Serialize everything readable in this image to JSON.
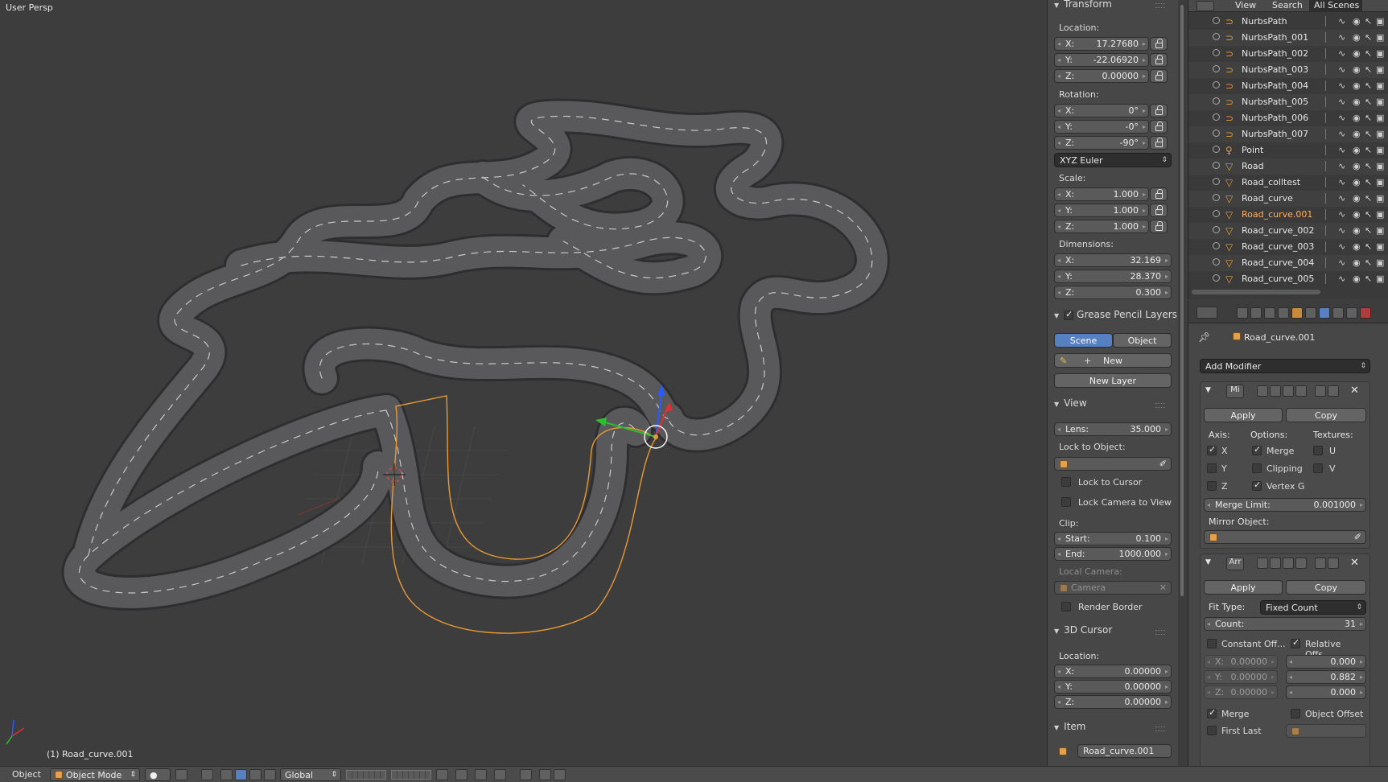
{
  "viewport": {
    "view_name": "User Persp",
    "object_info": "(1) Road_curve.001"
  },
  "npanel": {
    "transform": {
      "title": "Transform",
      "location_label": "Location:",
      "location": [
        {
          "k": "X:",
          "v": "17.27680"
        },
        {
          "k": "Y:",
          "v": "-22.06920"
        },
        {
          "k": "Z:",
          "v": "0.00000"
        }
      ],
      "rotation_label": "Rotation:",
      "rotation": [
        {
          "k": "X:",
          "v": "0°"
        },
        {
          "k": "Y:",
          "v": "-0°"
        },
        {
          "k": "Z:",
          "v": "-90°"
        }
      ],
      "rotation_mode": "XYZ Euler",
      "scale_label": "Scale:",
      "scale": [
        {
          "k": "X:",
          "v": "1.000"
        },
        {
          "k": "Y:",
          "v": "1.000"
        },
        {
          "k": "Z:",
          "v": "1.000"
        }
      ],
      "dimensions_label": "Dimensions:",
      "dimensions": [
        {
          "k": "X:",
          "v": "32.169"
        },
        {
          "k": "Y:",
          "v": "28.370"
        },
        {
          "k": "Z:",
          "v": "0.300"
        }
      ]
    },
    "grease": {
      "title": "Grease Pencil Layers",
      "scene": "Scene",
      "object": "Object",
      "new": "New",
      "new_layer": "New Layer"
    },
    "view": {
      "title": "View",
      "lens_k": "Lens:",
      "lens_v": "35.000",
      "lock_obj": "Lock to Object:",
      "lock_cursor": "Lock to Cursor",
      "lock_camera": "Lock Camera to View",
      "clip": "Clip:",
      "start_k": "Start:",
      "start_v": "0.100",
      "end_k": "End:",
      "end_v": "1000.000",
      "local_camera": "Local Camera:",
      "camera": "Camera",
      "render_border": "Render Border"
    },
    "cursor": {
      "title": "3D Cursor",
      "location_label": "Location:",
      "location": [
        {
          "k": "X:",
          "v": "0.00000"
        },
        {
          "k": "Y:",
          "v": "0.00000"
        },
        {
          "k": "Z:",
          "v": "0.00000"
        }
      ]
    },
    "item": {
      "title": "Item",
      "name": "Road_curve.001"
    }
  },
  "outliner": {
    "header": {
      "view": "View",
      "search": "Search",
      "scenes": "All Scenes"
    },
    "rows": [
      {
        "name": "NurbsPath",
        "type": "curve"
      },
      {
        "name": "NurbsPath_001",
        "type": "curve"
      },
      {
        "name": "NurbsPath_002",
        "type": "curve"
      },
      {
        "name": "NurbsPath_003",
        "type": "curve"
      },
      {
        "name": "NurbsPath_004",
        "type": "curve"
      },
      {
        "name": "NurbsPath_005",
        "type": "curve"
      },
      {
        "name": "NurbsPath_006",
        "type": "curve"
      },
      {
        "name": "NurbsPath_007",
        "type": "curve"
      },
      {
        "name": "Point",
        "type": "lamp"
      },
      {
        "name": "Road",
        "type": "mesh"
      },
      {
        "name": "Road_colltest",
        "type": "mesh"
      },
      {
        "name": "Road_curve",
        "type": "mesh"
      },
      {
        "name": "Road_curve.001",
        "type": "mesh",
        "selected": true
      },
      {
        "name": "Road_curve_002",
        "type": "mesh"
      },
      {
        "name": "Road_curve_003",
        "type": "mesh"
      },
      {
        "name": "Road_curve_004",
        "type": "mesh"
      },
      {
        "name": "Road_curve_005",
        "type": "mesh"
      }
    ]
  },
  "properties": {
    "object_name": "Road_curve.001",
    "add_modifier": "Add Modifier",
    "mirror": {
      "short": "Mi",
      "apply": "Apply",
      "copy": "Copy",
      "axis": "Axis:",
      "options": "Options:",
      "textures": "Textures:",
      "x": "X",
      "y": "Y",
      "z": "Z",
      "merge": "Merge",
      "clipping": "Clipping",
      "vertex_g": "Vertex G",
      "u": "U",
      "v": "V",
      "merge_limit_k": "Merge Limit:",
      "merge_limit_v": "0.001000",
      "mirror_object": "Mirror Object:"
    },
    "array": {
      "short": "Arr",
      "apply": "Apply",
      "copy": "Copy",
      "fit_type_label": "Fit Type:",
      "fit_type": "Fixed Count",
      "count_k": "Count:",
      "count_v": "31",
      "constant_off": "Constant Off...",
      "relative_offs": "Relative Offs...",
      "cx": "X:",
      "cy": "Y:",
      "cz": "Z:",
      "cval": "0.00000",
      "rx": "0.000",
      "ry": "0.882",
      "rz": "0.000",
      "merge": "Merge",
      "object_offset": "Object Offset",
      "first_last": "First Last"
    }
  },
  "header": {
    "object_menu": "Object",
    "mode": "Object Mode",
    "orientation": "Global"
  }
}
